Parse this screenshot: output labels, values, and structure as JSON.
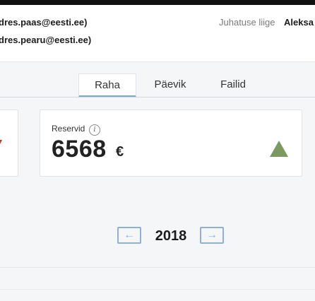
{
  "header": {
    "email_1": "dres.paas@eesti.ee)",
    "email_2": "dres.pearu@eesti.ee)",
    "role": "Juhatuse liige",
    "person": "Aleksa"
  },
  "tabs": [
    {
      "label": "Raha",
      "active": true
    },
    {
      "label": "Päevik",
      "active": false
    },
    {
      "label": "Failid",
      "active": false
    }
  ],
  "reserves_card": {
    "label": "Reservid",
    "info_icon": "info-icon",
    "value": "6568",
    "unit": "€",
    "trend": "up",
    "trend_color": "#7a9a5f"
  },
  "year_nav": {
    "prev_label": "←",
    "year": "2018",
    "next_label": "→",
    "accent": "#8fb0d8"
  }
}
